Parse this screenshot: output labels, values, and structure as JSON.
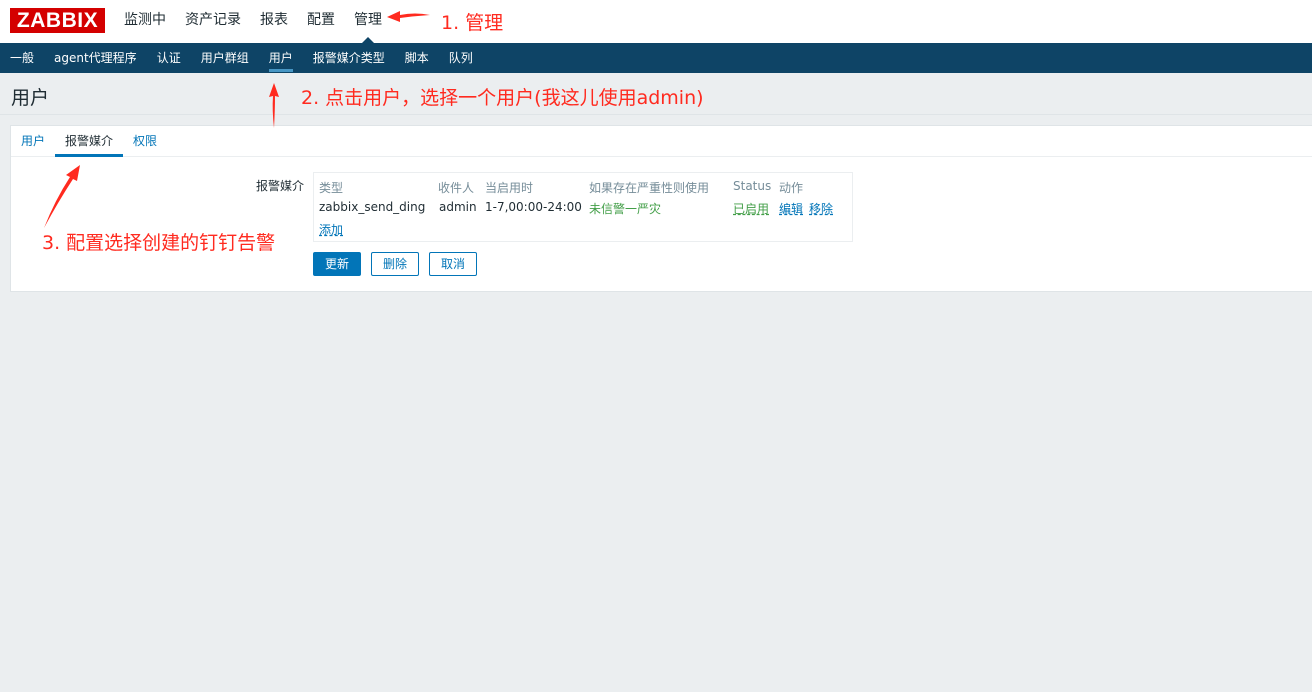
{
  "header": {
    "logo": "ZABBIX",
    "menu": [
      "监测中",
      "资产记录",
      "报表",
      "配置",
      "管理"
    ],
    "selected_menu": "管理"
  },
  "subnav": {
    "items": [
      "一般",
      "agent代理程序",
      "认证",
      "用户群组",
      "用户",
      "报警媒介类型",
      "脚本",
      "队列"
    ],
    "selected": "用户"
  },
  "page": {
    "title": "用户"
  },
  "tabs": [
    "用户",
    "报警媒介",
    "权限"
  ],
  "active_tab": "报警媒介",
  "form": {
    "label": "报警媒介",
    "table": {
      "headers": [
        "类型",
        "收件人",
        "当启用时",
        "如果存在严重性则使用",
        "Status",
        "动作"
      ],
      "row": {
        "type": "zabbix_send_ding",
        "recipient": "admin",
        "when_active": "1-7,00:00-24:00",
        "severity": "未信警一严灾",
        "status": "已启用",
        "edit": "编辑",
        "remove": "移除"
      },
      "add_link": "添加"
    },
    "buttons": {
      "update": "更新",
      "delete": "删除",
      "cancel": "取消"
    }
  },
  "annotations": {
    "step1": "1. 管理",
    "step2": "2. 点击用户，选择一个用户(我这儿使用admin)",
    "step3": "3. 配置选择创建的钉钉告警",
    "color": "#ff2a1f"
  },
  "colors": {
    "logo_bg": "#d40000",
    "subnav_bg": "#0e4466",
    "link": "#0275b8",
    "enabled": "#429e47",
    "background": "#ebeef0"
  }
}
